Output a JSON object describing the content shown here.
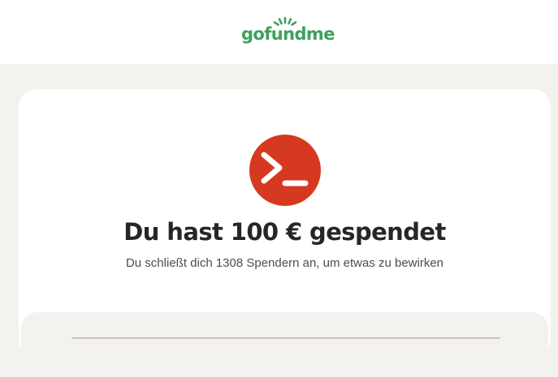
{
  "header": {
    "logo_text": "gofundme"
  },
  "donation": {
    "title": "Du hast 100 € gespendet",
    "subtitle": "Du schließt dich 1308 Spendern an, um etwas zu bewirken"
  },
  "colors": {
    "brand_green": "#3ea05a",
    "avatar_red": "#d5391f",
    "page_background": "#f4f2ef",
    "title_text": "#262626"
  },
  "icons": {
    "logo_sun": "sun-rays-icon",
    "avatar": "terminal-prompt-icon"
  }
}
